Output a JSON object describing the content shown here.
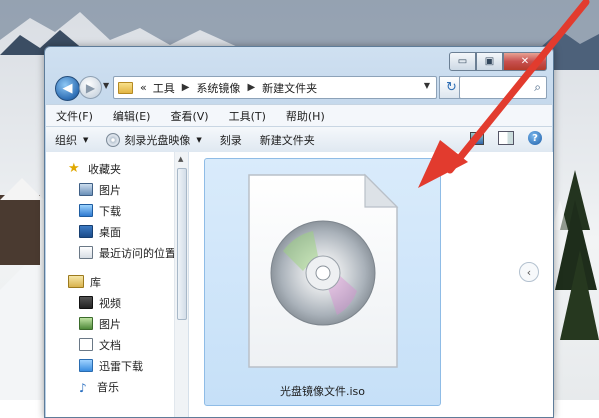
{
  "window": {
    "caption_buttons": {
      "minimize": "▭",
      "maximize": "▣",
      "close": "✕"
    }
  },
  "nav": {
    "back_glyph": "◀",
    "forward_glyph": "▶",
    "address_prefix": "«",
    "breadcrumbs": [
      "工具",
      "系统镜像",
      "新建文件夹"
    ],
    "refresh_glyph": "↻",
    "search_glyph": "🔍"
  },
  "menu": [
    "文件(F)",
    "编辑(E)",
    "查看(V)",
    "工具(T)",
    "帮助(H)"
  ],
  "toolbar": {
    "organize": "组织",
    "burn_image": "刻录光盘映像",
    "burn": "刻录",
    "new_folder": "新建文件夹",
    "help": "?"
  },
  "sidebar": {
    "favorites": {
      "label": "收藏夹",
      "items": [
        "图片",
        "下载",
        "桌面",
        "最近访问的位置"
      ]
    },
    "libraries": {
      "label": "库",
      "items": [
        "视频",
        "图片",
        "文档",
        "迅雷下载",
        "音乐"
      ]
    }
  },
  "content": {
    "file_name": "光盘镜像文件.iso",
    "pane_toggle": "‹"
  },
  "icons": {
    "back": "back-arrow-icon",
    "forward": "forward-arrow-icon",
    "folder": "folder-icon",
    "refresh": "refresh-icon",
    "search": "search-icon",
    "disc": "disc-icon",
    "help": "help-icon",
    "favorites": "star-icon",
    "annotation": "red-arrow-icon"
  },
  "colors": {
    "annotation_arrow": "#e23b2e",
    "selection": "#cde5fb",
    "window_frame": "#bcd2e8"
  }
}
